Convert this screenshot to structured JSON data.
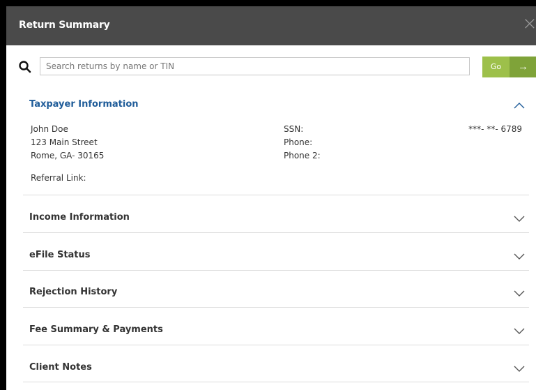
{
  "dialog": {
    "title": "Return Summary",
    "close_label": "×"
  },
  "search": {
    "placeholder": "Search returns by name or TIN",
    "value": "",
    "go_label": "Go",
    "go_arrow": "→"
  },
  "taxpayer": {
    "heading": "Taxpayer Information",
    "expanded": true,
    "name": "John Doe",
    "address_line1": "123 Main Street",
    "address_line2": "Rome, GA- 30165",
    "referral_label": "Referral Link:",
    "ssn_label": "SSN:",
    "ssn_value": "***- **- 6789",
    "phone_label": "Phone:",
    "phone2_label": "Phone 2:"
  },
  "sections": [
    {
      "title": "Income Information",
      "expanded": false
    },
    {
      "title": "eFile Status",
      "expanded": false
    },
    {
      "title": "Rejection History",
      "expanded": false
    },
    {
      "title": "Fee Summary & Payments",
      "expanded": false
    },
    {
      "title": "Client Notes",
      "expanded": false
    }
  ],
  "colors": {
    "header_bg": "#4a4a4a",
    "accent_blue": "#1f5c99",
    "go_green": "#9dc04a",
    "go_green_dark": "#7fa339"
  }
}
